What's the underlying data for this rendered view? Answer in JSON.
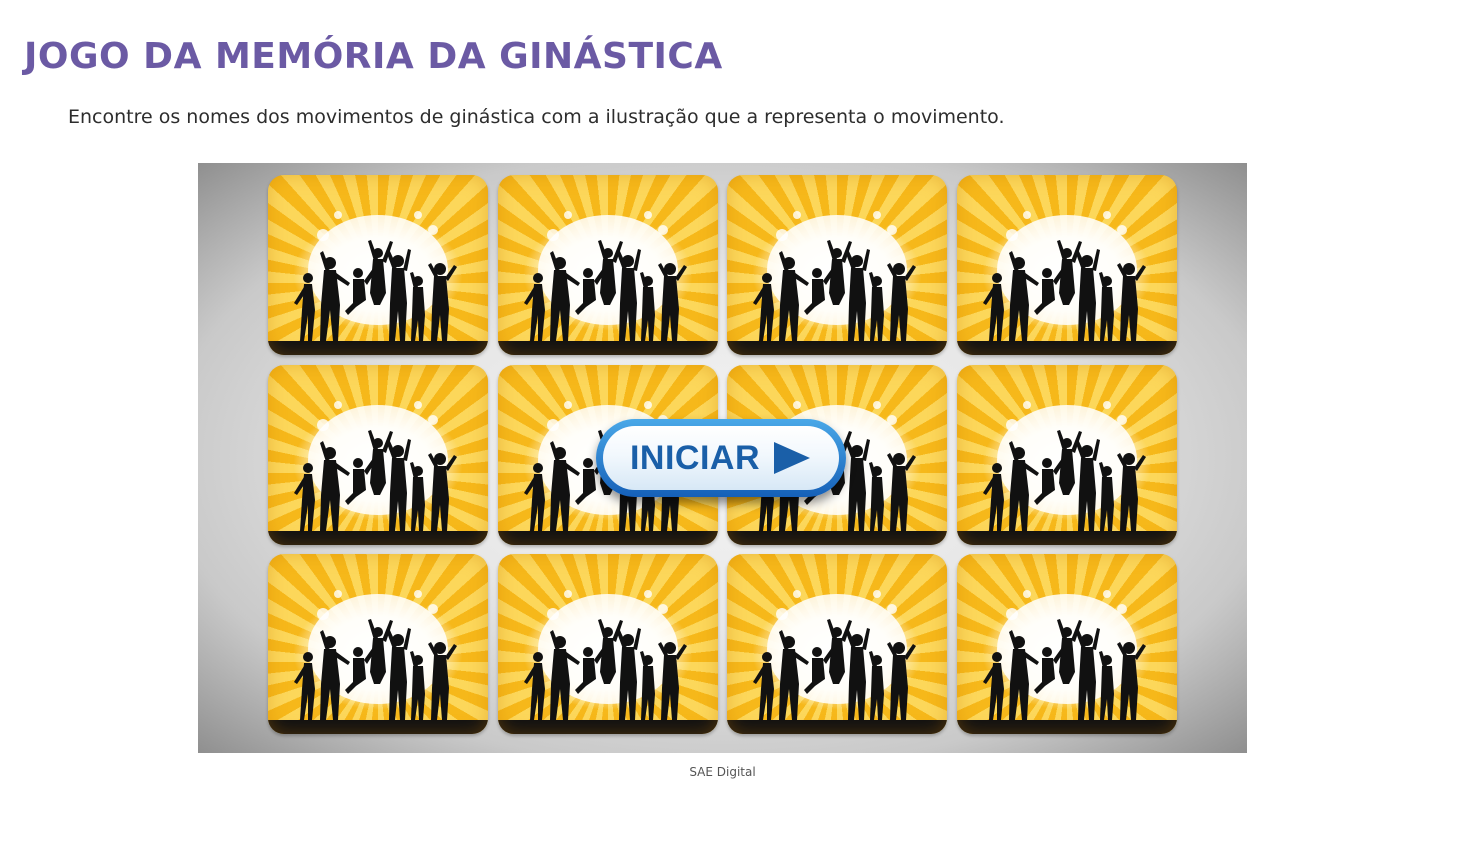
{
  "page": {
    "title": "JOGO DA MEMÓRIA DA GINÁSTICA",
    "instructions": "Encontre os nomes dos movimentos de ginástica com a ilustração que a representa o movimento."
  },
  "game": {
    "start_button_label": "INICIAR",
    "card_count": 12,
    "card_back_icon": "dancing-silhouettes-icon",
    "start_icon": "play-icon"
  },
  "caption": "SAE Digital",
  "colors": {
    "title": "#6b5aa4",
    "card_yellow": "#f6b81a",
    "button_blue": "#1a5fa8"
  }
}
